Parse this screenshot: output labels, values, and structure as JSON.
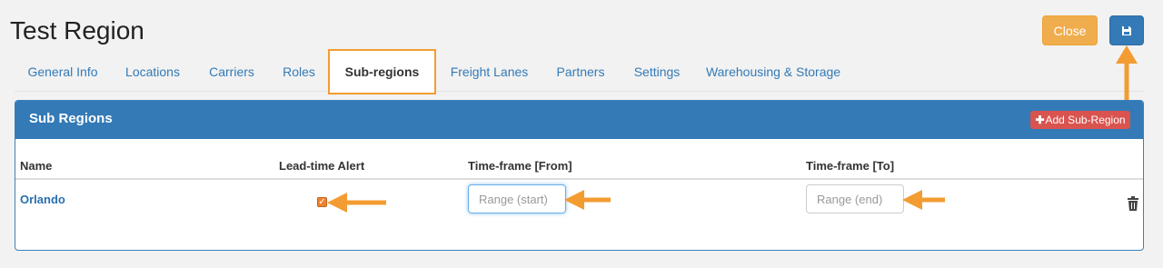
{
  "header": {
    "title": "Test Region"
  },
  "toolbar": {
    "close_label": "Close",
    "save_icon": "floppy-disk-icon"
  },
  "tabs": [
    {
      "label": "General Info",
      "active": false
    },
    {
      "label": "Locations",
      "active": false
    },
    {
      "label": "Carriers",
      "active": false
    },
    {
      "label": "Roles",
      "active": false
    },
    {
      "label": "Sub-regions",
      "active": true
    },
    {
      "label": "Freight Lanes",
      "active": false
    },
    {
      "label": "Partners",
      "active": false
    },
    {
      "label": "Settings",
      "active": false
    },
    {
      "label": "Warehousing & Storage",
      "active": false
    }
  ],
  "panel": {
    "title": "Sub Regions",
    "add_label": "Add Sub-Region",
    "add_icon": "plus-icon"
  },
  "table": {
    "columns": [
      "Name",
      "Lead-time Alert",
      "Time-frame [From]",
      "Time-frame [To]"
    ],
    "rows": [
      {
        "name": "Orlando",
        "lead_time_alert": true,
        "from_placeholder": "Range (start)",
        "to_placeholder": "Range (end)",
        "delete_icon": "trash-icon"
      }
    ]
  },
  "colors": {
    "primary": "#337ab7",
    "warning": "#f0ad4e",
    "danger": "#d9534f",
    "highlight": "#f39c32"
  }
}
